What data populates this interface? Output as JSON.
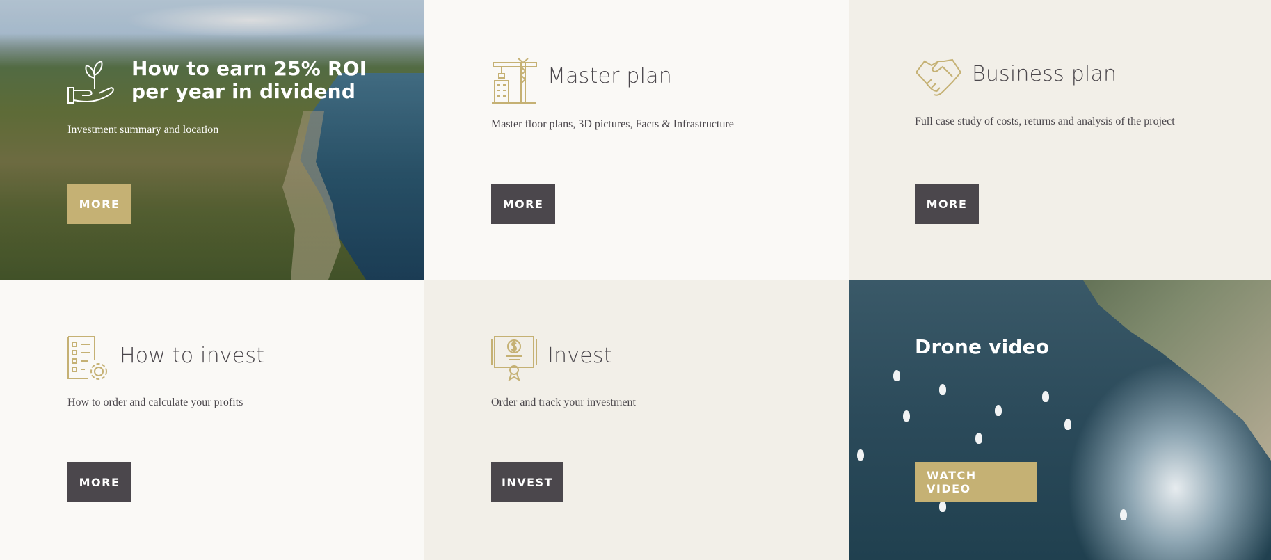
{
  "accent_gold": "#c5b174",
  "button_dark": "#4b474c",
  "tiles": [
    {
      "title_line1": "How to earn 25% ROI",
      "title_line2": "per year in dividend",
      "description": "Investment summary and location",
      "button": "MORE",
      "icon": "plant-hand-icon"
    },
    {
      "title": "Master plan",
      "description": "Master floor plans, 3D pictures, Facts & Infrastructure",
      "button": "MORE",
      "icon": "crane-building-icon"
    },
    {
      "title": "Business plan",
      "description": "Full case study of costs, returns and analysis of the project",
      "button": "MORE",
      "icon": "handshake-icon"
    },
    {
      "title": "How to invest",
      "description": "How to order and calculate your profits",
      "button": "MORE",
      "icon": "checklist-gear-icon"
    },
    {
      "title": "Invest",
      "description": "Order and track your investment",
      "button": "INVEST",
      "icon": "certificate-dollar-icon"
    },
    {
      "title": "Drone video",
      "button": "WATCH VIDEO"
    }
  ]
}
